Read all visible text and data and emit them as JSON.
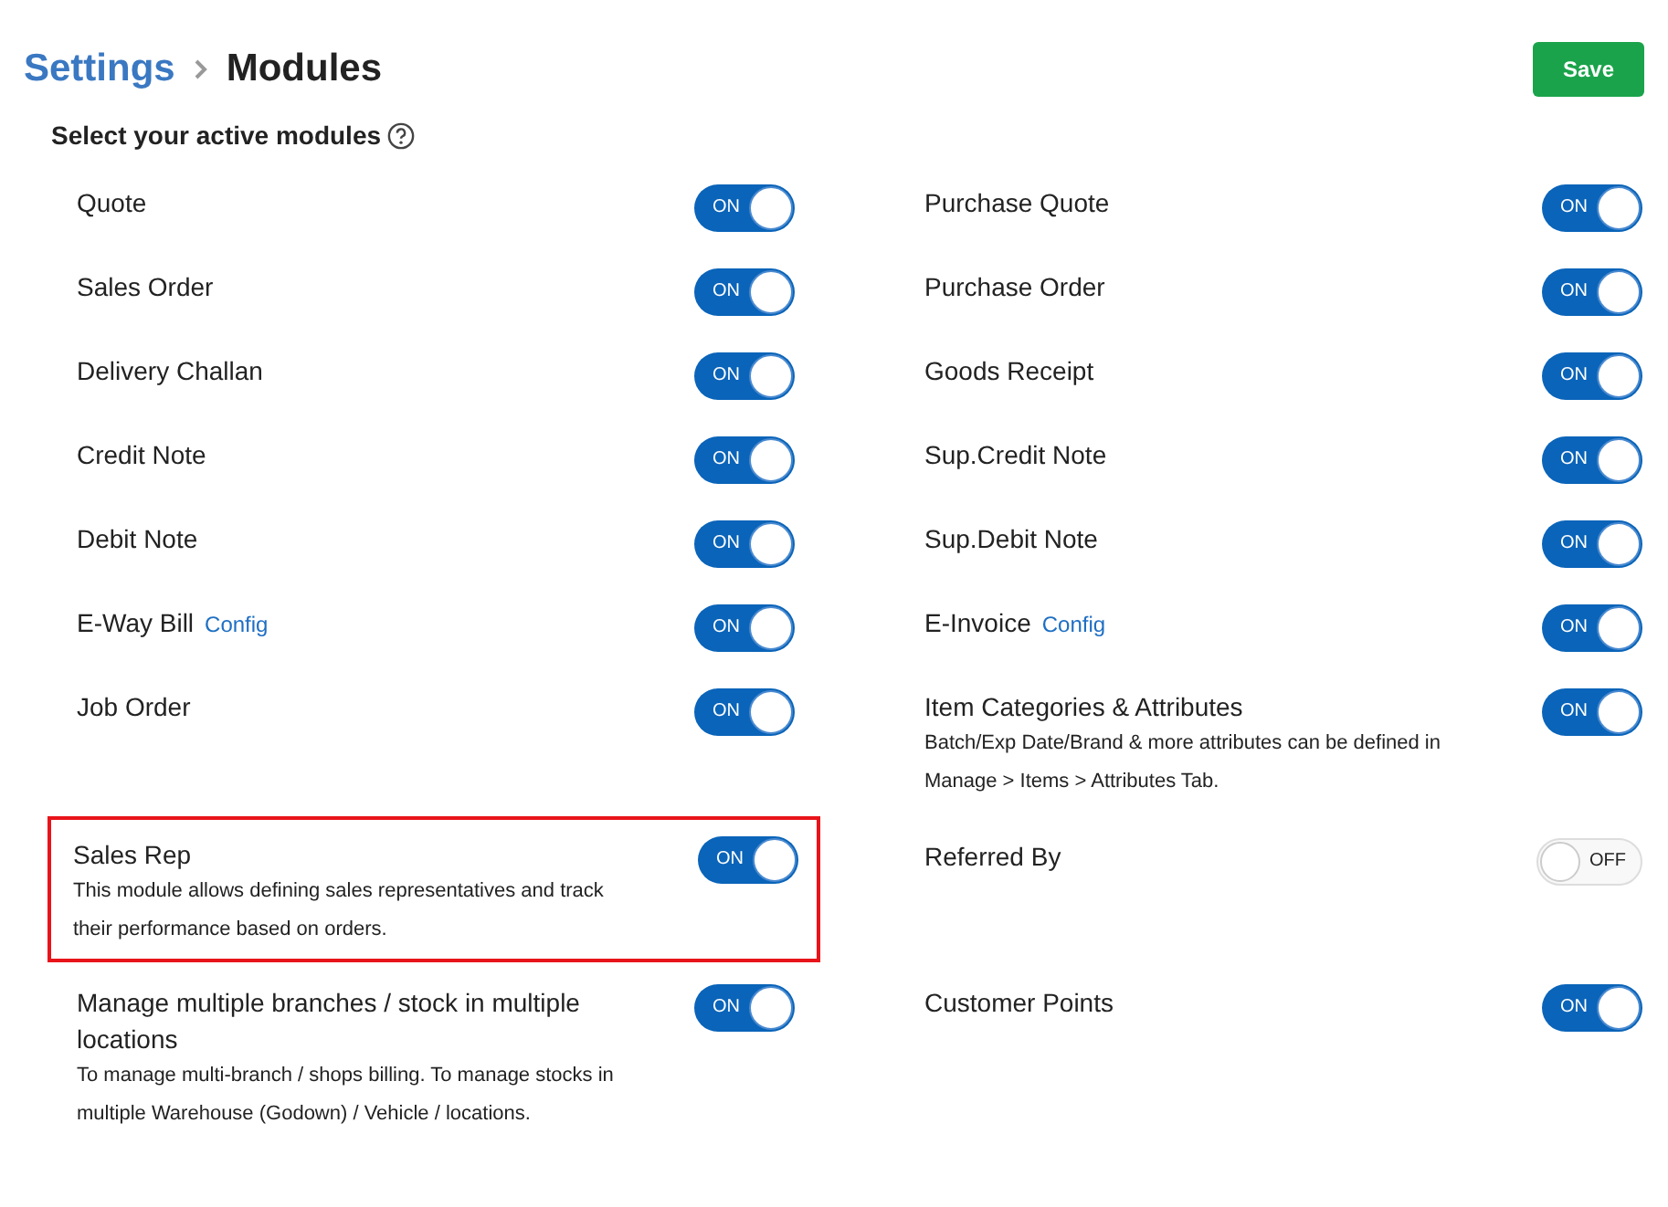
{
  "breadcrumb": {
    "parent": "Settings",
    "current": "Modules"
  },
  "save_button": "Save",
  "heading": "Select your active modules",
  "rows": [
    [
      {
        "label": "Quote",
        "on": true,
        "toggle_text": "ON"
      },
      {
        "label": "Purchase Quote",
        "on": true,
        "toggle_text": "ON"
      }
    ],
    [
      {
        "label": "Sales Order",
        "on": true,
        "toggle_text": "ON"
      },
      {
        "label": "Purchase Order",
        "on": true,
        "toggle_text": "ON"
      }
    ],
    [
      {
        "label": "Delivery Challan",
        "on": true,
        "toggle_text": "ON"
      },
      {
        "label": "Goods Receipt",
        "on": true,
        "toggle_text": "ON"
      }
    ],
    [
      {
        "label": "Credit Note",
        "on": true,
        "toggle_text": "ON"
      },
      {
        "label": "Sup.Credit Note",
        "on": true,
        "toggle_text": "ON"
      }
    ],
    [
      {
        "label": "Debit Note",
        "on": true,
        "toggle_text": "ON"
      },
      {
        "label": "Sup.Debit Note",
        "on": true,
        "toggle_text": "ON"
      }
    ],
    [
      {
        "label": "E-Way Bill",
        "link": "Config",
        "on": true,
        "toggle_text": "ON"
      },
      {
        "label": "E-Invoice",
        "link": "Config",
        "on": true,
        "toggle_text": "ON"
      }
    ],
    [
      {
        "label": "Job Order",
        "on": true,
        "toggle_text": "ON"
      },
      {
        "label": "Item Categories & Attributes",
        "description": "Batch/Exp Date/Brand & more attributes can be defined in Manage > Items > Attributes Tab.",
        "on": true,
        "toggle_text": "ON"
      }
    ],
    [
      {
        "label": "Sales Rep",
        "description": "This module allows defining sales representatives and track their performance based on orders.",
        "highlighted": true,
        "on": true,
        "toggle_text": "ON"
      },
      {
        "label": "Referred By",
        "on": false,
        "toggle_text": "OFF"
      }
    ],
    [
      {
        "label": "Manage multiple branches / stock in multiple locations",
        "description": "To manage multi-branch / shops billing. To manage stocks in multiple Warehouse (Godown) / Vehicle / locations.",
        "on": true,
        "toggle_text": "ON"
      },
      {
        "label": "Customer Points",
        "on": true,
        "toggle_text": "ON"
      }
    ]
  ]
}
